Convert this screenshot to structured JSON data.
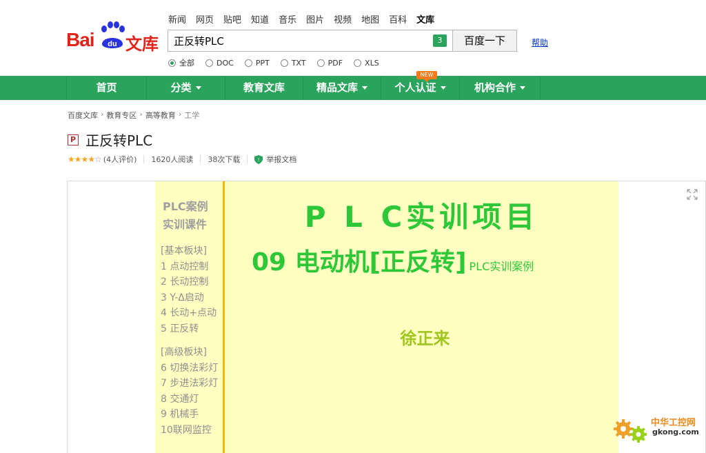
{
  "brand": {
    "bai": "Bai",
    "du": "du",
    "wenku": "文库"
  },
  "topnav": [
    "新闻",
    "网页",
    "贴吧",
    "知道",
    "音乐",
    "图片",
    "视频",
    "地图",
    "百科",
    "文库"
  ],
  "search": {
    "value": "正反转PLC",
    "badge": "3",
    "button": "百度一下",
    "help": "帮助"
  },
  "filters": [
    {
      "label": "全部",
      "selected": true
    },
    {
      "label": "DOC",
      "selected": false
    },
    {
      "label": "PPT",
      "selected": false
    },
    {
      "label": "TXT",
      "selected": false
    },
    {
      "label": "PDF",
      "selected": false
    },
    {
      "label": "XLS",
      "selected": false
    }
  ],
  "mainnav": [
    {
      "label": "首页",
      "caret": false
    },
    {
      "label": "分类",
      "caret": true
    },
    {
      "label": "教育文库",
      "caret": false
    },
    {
      "label": "精品文库",
      "caret": true
    },
    {
      "label": "个人认证",
      "caret": true
    },
    {
      "label": "机构合作",
      "caret": true
    }
  ],
  "new_badge": "NEW",
  "breadcrumb": [
    "百度文库",
    "教育专区",
    "高等教育",
    "工学"
  ],
  "doc": {
    "type_icon": "P",
    "title": "正反转PLC",
    "rating_count": "(4人评价)",
    "rating": 4,
    "reads": "1620人阅读",
    "downloads": "38次下载",
    "report": "举报文档"
  },
  "slide": {
    "side_title_1": "PLC案例",
    "side_title_2": "实训课件",
    "basic_header": "[基本板块]",
    "basic_items": [
      "1 点动控制",
      "2 长动控制",
      "3 Y-Δ启动",
      "4 长动+点动",
      "5 正反转"
    ],
    "adv_header": "[高级板块]",
    "adv_items": [
      "6 切换法彩灯",
      "7 步进法彩灯",
      "8 交通灯",
      "9 机械手",
      "10联网监控"
    ],
    "main_title": "P L C实训项目",
    "subtitle": "09 电动机[正反转]",
    "subtitle_small": "PLC实训案例",
    "author": "徐正来"
  },
  "watermark": {
    "line1": "中华工控网",
    "line2": "gkong.com"
  },
  "colors": {
    "green": "#2aa35d",
    "slide_bg": "#ffffc2",
    "title_green": "#2dc738",
    "brand_red": "#e2231a"
  },
  "icons": [
    "baidu-paw-icon",
    "shield-icon",
    "expand-icon",
    "gear-icon"
  ]
}
